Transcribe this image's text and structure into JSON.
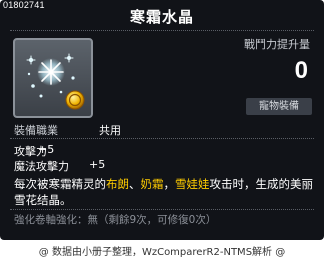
{
  "item": {
    "id": "01802741",
    "name": "寒霜水晶"
  },
  "power": {
    "label": "戰鬥力提升量",
    "value": "0"
  },
  "pet_equip_label": "寵物裝備",
  "job": {
    "label": "裝備職業",
    "value": "共用"
  },
  "stats": [
    {
      "label": "攻擊力",
      "value": "+5"
    },
    {
      "label": "魔法攻擊力",
      "value": "+5"
    }
  ],
  "description": {
    "prefix": "每次被寒霜精灵的",
    "name1": "布朗",
    "sep1": "、",
    "name2": "奶霜",
    "sep2": "，",
    "name3": "雪娃娃",
    "suffix": "攻击时，生成的美丽雪花结晶。"
  },
  "upgrade": "強化卷軸強化：無（剩餘9次，可修復0次）",
  "footer": "@ 数据由小册子整理，WzComparerR2-NTMS解析 @",
  "icons": {
    "item": "frost-crystal-icon",
    "coin": "gold-coin-icon"
  }
}
